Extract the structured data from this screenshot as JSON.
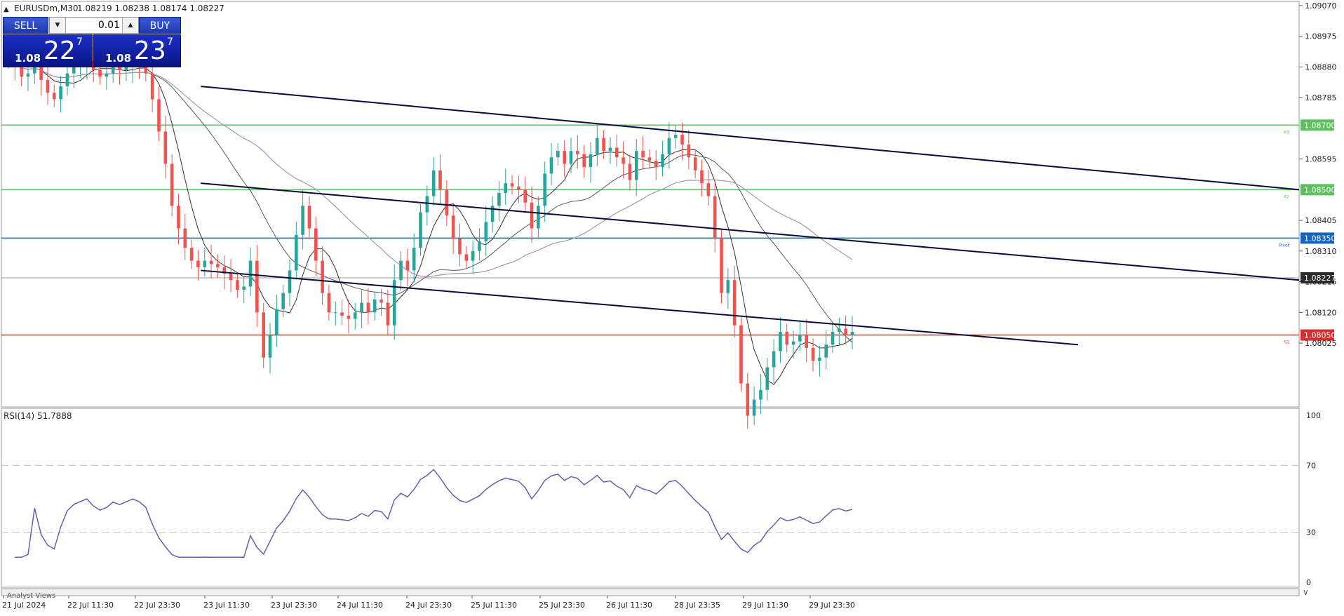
{
  "window": {
    "title": "EURUSDm,M30",
    "ohlc": "1.08219 1.08238 1.08174 1.08227"
  },
  "trade_panel": {
    "sell_label": "SELL",
    "buy_label": "BUY",
    "lot_value": "0.01",
    "bid": {
      "small": "1.08",
      "big": "22",
      "sup": "7"
    },
    "ask": {
      "small": "1.08",
      "big": "23",
      "sup": "7"
    }
  },
  "rsi": {
    "label": "RSI(14) 51.7888",
    "levels": [
      100,
      70,
      30,
      0
    ]
  },
  "bottom_tab": "Analyst Views",
  "colors": {
    "bull": "#26a69a",
    "bear": "#ef5350",
    "support_resistance": "#5dbf5d",
    "pivot": "#1565c0",
    "s1": "#d32f2f",
    "channel": "#0a0a3c",
    "rsi_line": "#6a5bb5",
    "ma_purple": "#a894b8",
    "ma_gray": "#5a5a5a",
    "ma_dark": "#3a2a2a"
  },
  "chart_data": {
    "type": "candlestick",
    "symbol": "EURUSDm",
    "timeframe": "M30",
    "ylim": [
      1.08025,
      1.0907
    ],
    "y_ticks": [
      1.0907,
      1.08975,
      1.0888,
      1.08785,
      1.08595,
      1.08405,
      1.0831,
      1.08215,
      1.0812,
      1.08025
    ],
    "x_ticks": [
      "21 Jul 2024",
      "22 Jul 11:30",
      "22 Jul 23:30",
      "23 Jul 11:30",
      "23 Jul 23:30",
      "24 Jul 11:30",
      "24 Jul 23:30",
      "25 Jul 11:30",
      "25 Jul 23:30",
      "26 Jul 11:30",
      "28 Jul 23:35",
      "29 Jul 11:30",
      "29 Jul 23:30"
    ],
    "current_price": 1.08227,
    "current_price_label": "1.08227",
    "horizontal_levels": [
      {
        "price": 1.087,
        "label": "1.08700",
        "tag": "R3",
        "color": "#5dbf5d"
      },
      {
        "price": 1.085,
        "label": "1.08500",
        "tag": "R2",
        "color": "#5dbf5d"
      },
      {
        "price": 1.0835,
        "label": "1.08350",
        "tag": "Pivot",
        "color": "#1565c0"
      },
      {
        "price": 1.0805,
        "label": "1.08050",
        "tag": "S1",
        "color": "#d32f2f"
      }
    ],
    "channel_lines": [
      {
        "from": [
          10,
          1.0882
        ],
        "to": [
          140,
          1.085
        ]
      },
      {
        "from": [
          10,
          1.0852
        ],
        "to": [
          140,
          1.0822
        ]
      },
      {
        "from": [
          10,
          1.0825
        ],
        "to": [
          112,
          1.0802
        ]
      }
    ],
    "closes": [
      1.089,
      1.0888,
      1.0885,
      1.0886,
      1.0889,
      1.0884,
      1.088,
      1.0878,
      1.0882,
      1.0886,
      1.0888,
      1.0889,
      1.089,
      1.0887,
      1.0885,
      1.0886,
      1.0888,
      1.0887,
      1.0888,
      1.0889,
      1.0888,
      1.0886,
      1.0878,
      1.0868,
      1.0858,
      1.0845,
      1.0838,
      1.0832,
      1.0828,
      1.0826,
      1.0828,
      1.0827,
      1.0826,
      1.0824,
      1.0822,
      1.0819,
      1.082,
      1.0828,
      1.0812,
      1.0798,
      1.0805,
      1.0813,
      1.0818,
      1.0825,
      1.0836,
      1.0845,
      1.0838,
      1.0828,
      1.0818,
      1.0812,
      1.0812,
      1.0811,
      1.081,
      1.0812,
      1.0815,
      1.0812,
      1.0816,
      1.0815,
      1.0808,
      1.0822,
      1.0828,
      1.0825,
      1.0832,
      1.0843,
      1.0848,
      1.0856,
      1.085,
      1.0842,
      1.0835,
      1.083,
      1.0828,
      1.0831,
      1.0834,
      1.084,
      1.0845,
      1.0849,
      1.0852,
      1.0851,
      1.085,
      1.0846,
      1.0838,
      1.0845,
      1.0855,
      1.086,
      1.0862,
      1.0858,
      1.0862,
      1.0861,
      1.0857,
      1.0861,
      1.0866,
      1.0862,
      1.0863,
      1.086,
      1.0858,
      1.0853,
      1.0862,
      1.086,
      1.0859,
      1.0857,
      1.0861,
      1.0866,
      1.0867,
      1.0864,
      1.086,
      1.0856,
      1.0852,
      1.0848,
      1.0835,
      1.0818,
      1.0822,
      1.0808,
      1.079,
      1.078,
      1.0785,
      1.0788,
      1.0795,
      1.08,
      1.0806,
      1.0802,
      1.0803,
      1.0805,
      1.0801,
      1.0797,
      1.0798,
      1.0802,
      1.0806,
      1.0807,
      1.0805,
      1.0806
    ]
  }
}
